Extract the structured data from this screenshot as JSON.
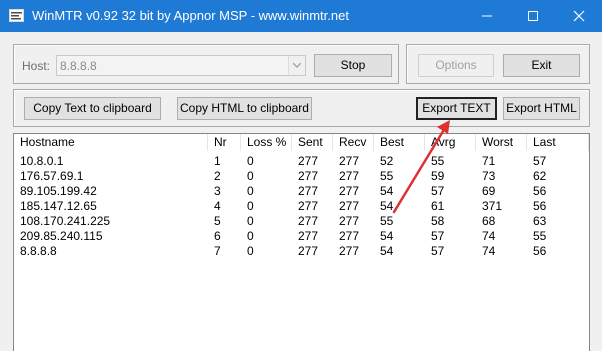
{
  "window": {
    "title": "WinMTR v0.92 32 bit by Appnor MSP - www.winmtr.net",
    "colors": {
      "titlebar": "#1f7ad6",
      "annotation_arrow": "#e03030"
    }
  },
  "host": {
    "label": "Host:",
    "value": "8.8.8.8"
  },
  "buttons": {
    "stop": "Stop",
    "options": "Options",
    "exit": "Exit",
    "copy_text": "Copy Text to clipboard",
    "copy_html": "Copy HTML to clipboard",
    "export_text": "Export TEXT",
    "export_html": "Export HTML"
  },
  "table": {
    "columns": [
      "Hostname",
      "Nr",
      "Loss %",
      "Sent",
      "Recv",
      "Best",
      "Avrg",
      "Worst",
      "Last"
    ],
    "rows": [
      [
        "10.8.0.1",
        "1",
        "0",
        "277",
        "277",
        "52",
        "55",
        "71",
        "57"
      ],
      [
        "176.57.69.1",
        "2",
        "0",
        "277",
        "277",
        "55",
        "59",
        "73",
        "62"
      ],
      [
        "89.105.199.42",
        "3",
        "0",
        "277",
        "277",
        "54",
        "57",
        "69",
        "56"
      ],
      [
        "185.147.12.65",
        "4",
        "0",
        "277",
        "277",
        "54",
        "61",
        "371",
        "56"
      ],
      [
        "108.170.241.225",
        "5",
        "0",
        "277",
        "277",
        "55",
        "58",
        "68",
        "63"
      ],
      [
        "209.85.240.115",
        "6",
        "0",
        "277",
        "277",
        "54",
        "57",
        "74",
        "55"
      ],
      [
        "8.8.8.8",
        "7",
        "0",
        "277",
        "277",
        "54",
        "57",
        "74",
        "56"
      ]
    ]
  }
}
